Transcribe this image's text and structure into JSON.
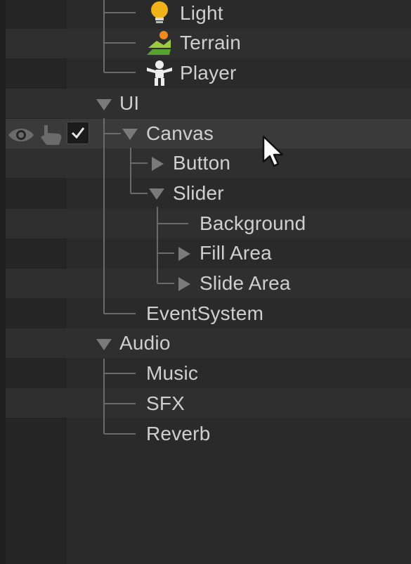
{
  "hierarchy": {
    "items": [
      {
        "label": "Light"
      },
      {
        "label": "Terrain"
      },
      {
        "label": "Player"
      },
      {
        "label": "UI"
      },
      {
        "label": "Canvas"
      },
      {
        "label": "Button"
      },
      {
        "label": "Slider"
      },
      {
        "label": "Background"
      },
      {
        "label": "Fill Area"
      },
      {
        "label": "Slide Area"
      },
      {
        "label": "EventSystem"
      },
      {
        "label": "Audio"
      },
      {
        "label": "Music"
      },
      {
        "label": "SFX"
      },
      {
        "label": "Reverb"
      }
    ],
    "canvas_row": {
      "visibility_icon": "eye-icon",
      "pickability_icon": "hand-pointer-icon",
      "active_checked": true
    }
  },
  "colors": {
    "background": "#2a2a2a",
    "row_alt": "#2f2f2f",
    "row_hover": "#3a3a3a",
    "text": "#cfcfcf",
    "arrow": "#7a7a7a",
    "tree_line": "#6a6a6a"
  }
}
